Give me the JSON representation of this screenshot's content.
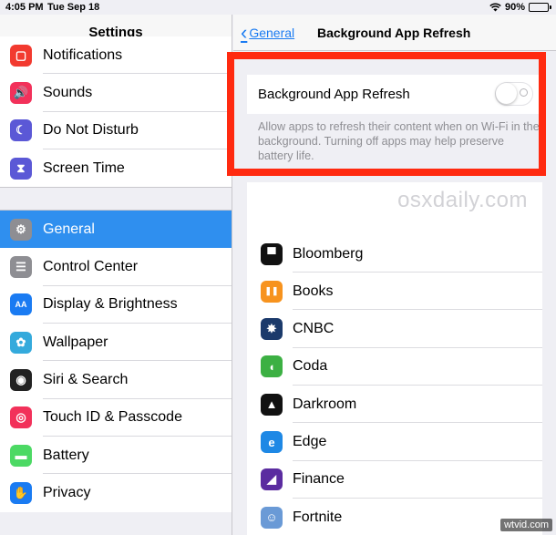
{
  "status_bar": {
    "time": "4:05 PM",
    "date": "Tue Sep 18",
    "battery": "90%",
    "battery_level": 0.9
  },
  "sidebar": {
    "title": "Settings",
    "group1": [
      {
        "label": "Notifications",
        "icon": "notifications-icon",
        "color": "#f23a2f"
      },
      {
        "label": "Sounds",
        "icon": "sounds-icon",
        "color": "#f2315a"
      },
      {
        "label": "Do Not Disturb",
        "icon": "moon-icon",
        "color": "#5b58d6"
      },
      {
        "label": "Screen Time",
        "icon": "hourglass-icon",
        "color": "#5b58d6"
      }
    ],
    "group2": [
      {
        "label": "General",
        "icon": "gear-icon",
        "color": "#8e8e93",
        "selected": true
      },
      {
        "label": "Control Center",
        "icon": "control-center-icon",
        "color": "#8e8e93"
      },
      {
        "label": "Display & Brightness",
        "icon": "display-icon",
        "color": "#1a7bf2"
      },
      {
        "label": "Wallpaper",
        "icon": "wallpaper-icon",
        "color": "#34aadc"
      },
      {
        "label": "Siri & Search",
        "icon": "siri-icon",
        "color": "#222"
      },
      {
        "label": "Touch ID & Passcode",
        "icon": "fingerprint-icon",
        "color": "#f2315a"
      },
      {
        "label": "Battery",
        "icon": "battery-icon",
        "color": "#4cd964"
      },
      {
        "label": "Privacy",
        "icon": "hand-icon",
        "color": "#1a7bf2"
      }
    ]
  },
  "detail": {
    "back_label": "General",
    "title": "Background App Refresh",
    "toggle_label": "Background App Refresh",
    "toggle_on": false,
    "footnote": "Allow apps to refresh their content when on Wi-Fi in the background. Turning off apps may help preserve battery life.",
    "watermark": "osxdaily.com",
    "apps": [
      {
        "label": "Bloomberg",
        "icon": "bloomberg-icon",
        "color": "#111"
      },
      {
        "label": "Books",
        "icon": "books-icon",
        "color": "#f7931e"
      },
      {
        "label": "CNBC",
        "icon": "cnbc-icon",
        "color": "#1b3a6b"
      },
      {
        "label": "Coda",
        "icon": "coda-icon",
        "color": "#3cb043"
      },
      {
        "label": "Darkroom",
        "icon": "darkroom-icon",
        "color": "#111"
      },
      {
        "label": "Edge",
        "icon": "edge-icon",
        "color": "#1e88e5"
      },
      {
        "label": "Finance",
        "icon": "finance-icon",
        "color": "#5b2ca0"
      },
      {
        "label": "Fortnite",
        "icon": "fortnite-icon",
        "color": "#6a9ad6"
      }
    ]
  },
  "corner_watermark": "wtvid.com"
}
